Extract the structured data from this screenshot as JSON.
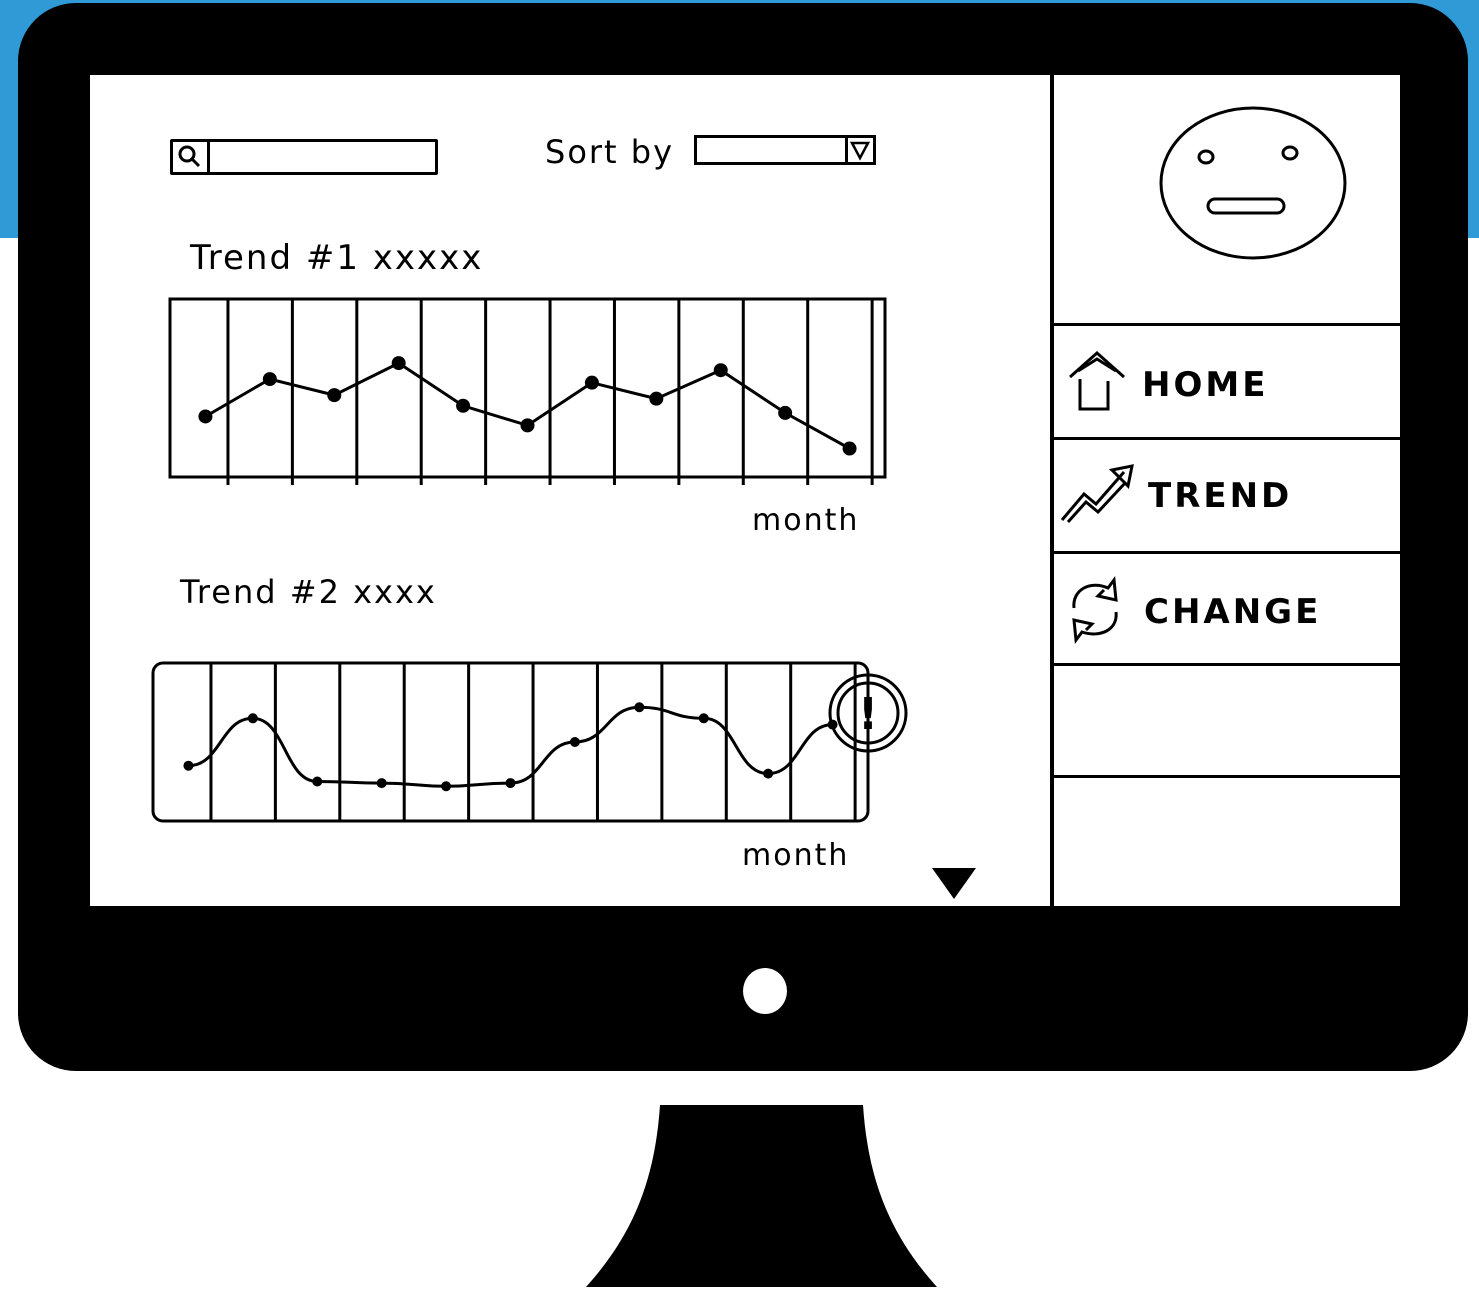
{
  "colors": {
    "background_accent": "#2f9ad6",
    "monitor_bezel": "#000000",
    "screen": "#ffffff"
  },
  "header": {
    "search": {
      "value": ""
    },
    "sort": {
      "label": "Sort by",
      "selected_value": ""
    }
  },
  "trends": [
    {
      "title": "Trend #1 xxxxx",
      "xlabel": "month"
    },
    {
      "title": "Trend #2 xxxx",
      "xlabel": "month"
    }
  ],
  "sidebar": {
    "items": [
      {
        "label": "HOME",
        "icon": "home-icon"
      },
      {
        "label": "TREND",
        "icon": "trend-icon"
      },
      {
        "label": "CHANGE",
        "icon": "change-icon"
      }
    ]
  },
  "chart_data": [
    {
      "type": "line",
      "title": "Trend #1 xxxxx",
      "xlabel": "month",
      "ylabel": "",
      "x": [
        1,
        2,
        3,
        4,
        5,
        6,
        7,
        8,
        9,
        10,
        11,
        12
      ],
      "series": [
        {
          "values": [
            3.4,
            5.5,
            4.6,
            6.4,
            4.0,
            2.9,
            5.3,
            4.4,
            6.0,
            3.6,
            1.6
          ]
        }
      ],
      "ylim": [
        0,
        10
      ],
      "grid": true
    },
    {
      "type": "line",
      "title": "Trend #2 xxxx",
      "xlabel": "month",
      "ylabel": "",
      "series": [
        {
          "values": [
            3.5,
            6.5,
            2.5,
            2.4,
            2.2,
            2.4,
            5.0,
            7.2,
            6.5,
            3.0,
            6.1
          ]
        }
      ],
      "ylim": [
        0,
        10
      ],
      "grid": true,
      "annotation": "!"
    }
  ]
}
